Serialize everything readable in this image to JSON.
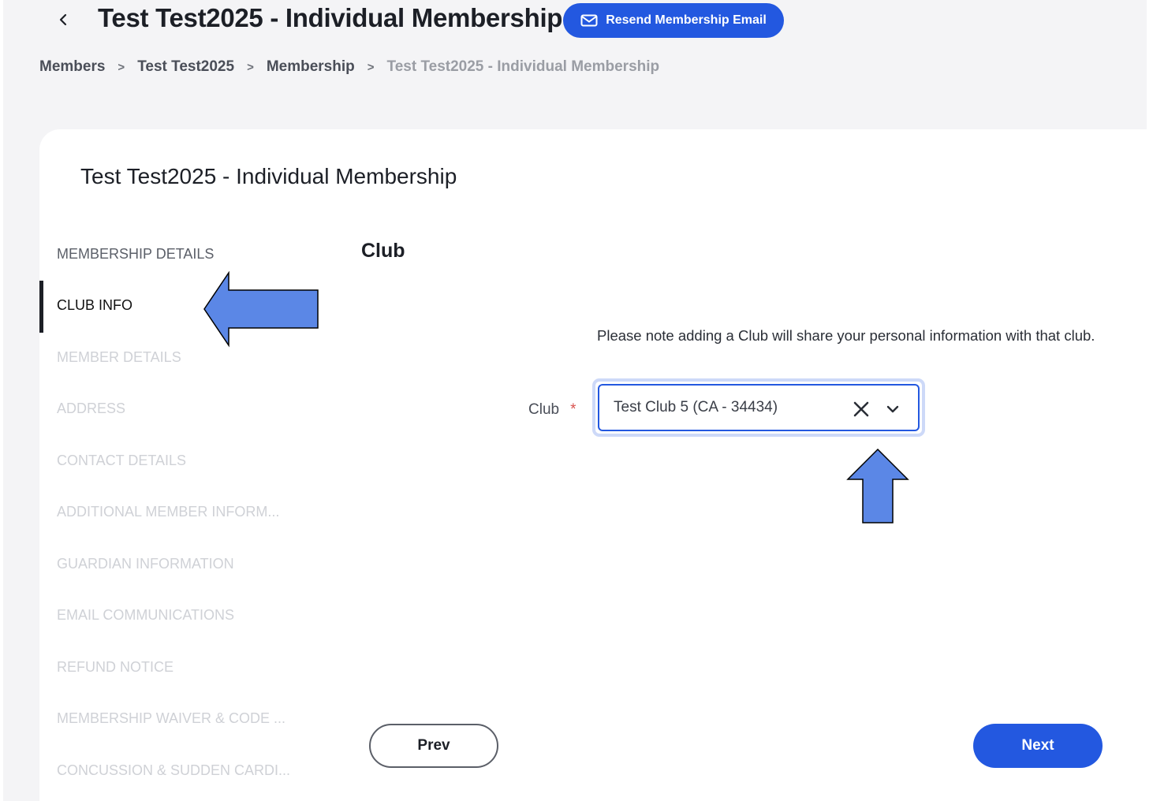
{
  "header": {
    "title": "Test Test2025 - Individual Membership",
    "resend_label": "Resend Membership Email"
  },
  "breadcrumb": [
    {
      "label": "Members"
    },
    {
      "label": "Test Test2025"
    },
    {
      "label": "Membership"
    },
    {
      "label": "Test Test2025 - Individual Membership"
    }
  ],
  "breadcrumb_separator": ">",
  "card": {
    "title": "Test Test2025 - Individual Membership"
  },
  "nav": {
    "items": [
      {
        "label": "MEMBERSHIP DETAILS",
        "state": "done"
      },
      {
        "label": "CLUB INFO",
        "state": "active"
      },
      {
        "label": "MEMBER DETAILS",
        "state": "pending"
      },
      {
        "label": "ADDRESS",
        "state": "pending"
      },
      {
        "label": "CONTACT DETAILS",
        "state": "pending"
      },
      {
        "label": "ADDITIONAL MEMBER INFORM...",
        "state": "pending"
      },
      {
        "label": "GUARDIAN INFORMATION",
        "state": "pending"
      },
      {
        "label": "EMAIL COMMUNICATIONS",
        "state": "pending"
      },
      {
        "label": "REFUND NOTICE",
        "state": "pending"
      },
      {
        "label": "MEMBERSHIP WAIVER & CODE ...",
        "state": "pending"
      },
      {
        "label": "CONCUSSION & SUDDEN CARDI...",
        "state": "pending"
      }
    ]
  },
  "form": {
    "section_title": "Club",
    "note": "Please note adding a Club will share your personal information with that club.",
    "club_label": "Club",
    "required_mark": "*",
    "club_value": "Test Club 5 (CA - 34434)"
  },
  "footer": {
    "prev_label": "Prev",
    "next_label": "Next"
  },
  "colors": {
    "accent": "#2358e0",
    "annotation_arrow": "#5b87e6"
  },
  "icons": {
    "back": "chevron-left-icon",
    "mail": "mail-icon",
    "clear": "close-icon",
    "dropdown": "chevron-down-icon"
  }
}
